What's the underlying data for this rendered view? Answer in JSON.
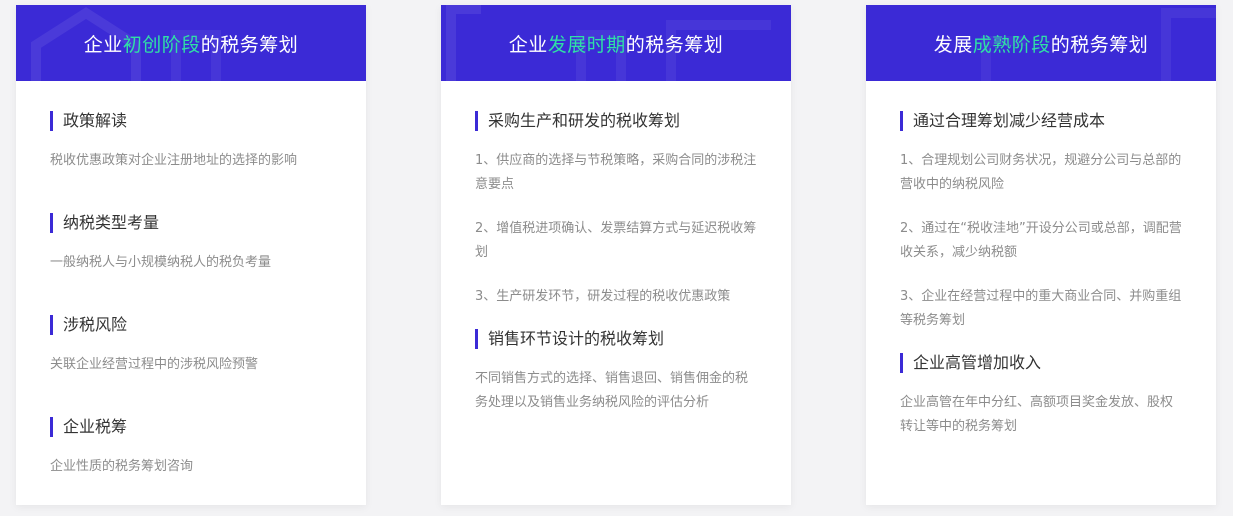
{
  "colors": {
    "header_bg": "#3b2ad6",
    "highlight": "#2fe0a6",
    "accent_bar": "#3b2ad6"
  },
  "cards": [
    {
      "title_pre": "企业",
      "title_hl": "初创阶段",
      "title_post": "的税务筹划",
      "sections": [
        {
          "title": "政策解读",
          "items": [
            "税收优惠政策对企业注册地址的选择的影响"
          ]
        },
        {
          "title": "纳税类型考量",
          "items": [
            "一般纳税人与小规模纳税人的税负考量"
          ]
        },
        {
          "title": "涉税风险",
          "items": [
            "关联企业经营过程中的涉税风险预警"
          ]
        },
        {
          "title": "企业税筹",
          "items": [
            "企业性质的税务筹划咨询"
          ]
        }
      ]
    },
    {
      "title_pre": "企业",
      "title_hl": "发展时期",
      "title_post": "的税务筹划",
      "sections": [
        {
          "title": "采购生产和研发的税收筹划",
          "items": [
            "1、供应商的选择与节税策略，采购合同的涉税注意要点",
            "2、增值税进项确认、发票结算方式与延迟税收筹划",
            "3、生产研发环节，研发过程的税收优惠政策"
          ]
        },
        {
          "title": "销售环节设计的税收筹划",
          "items": [
            "不同销售方式的选择、销售退回、销售佣金的税务处理以及销售业务纳税风险的评估分析"
          ]
        }
      ]
    },
    {
      "title_pre": "发展",
      "title_hl": "成熟阶段",
      "title_post": "的税务筹划",
      "sections": [
        {
          "title": "通过合理筹划减少经营成本",
          "items": [
            "1、合理规划公司财务状况，规避分公司与总部的营收中的纳税风险",
            "2、通过在“税收洼地”开设分公司或总部，调配营收关系，减少纳税额",
            "3、企业在经营过程中的重大商业合同、并购重组等税务筹划"
          ]
        },
        {
          "title": "企业高管增加收入",
          "items": [
            "企业高管在年中分红、高额项目奖金发放、股权转让等中的税务筹划"
          ]
        }
      ]
    }
  ]
}
